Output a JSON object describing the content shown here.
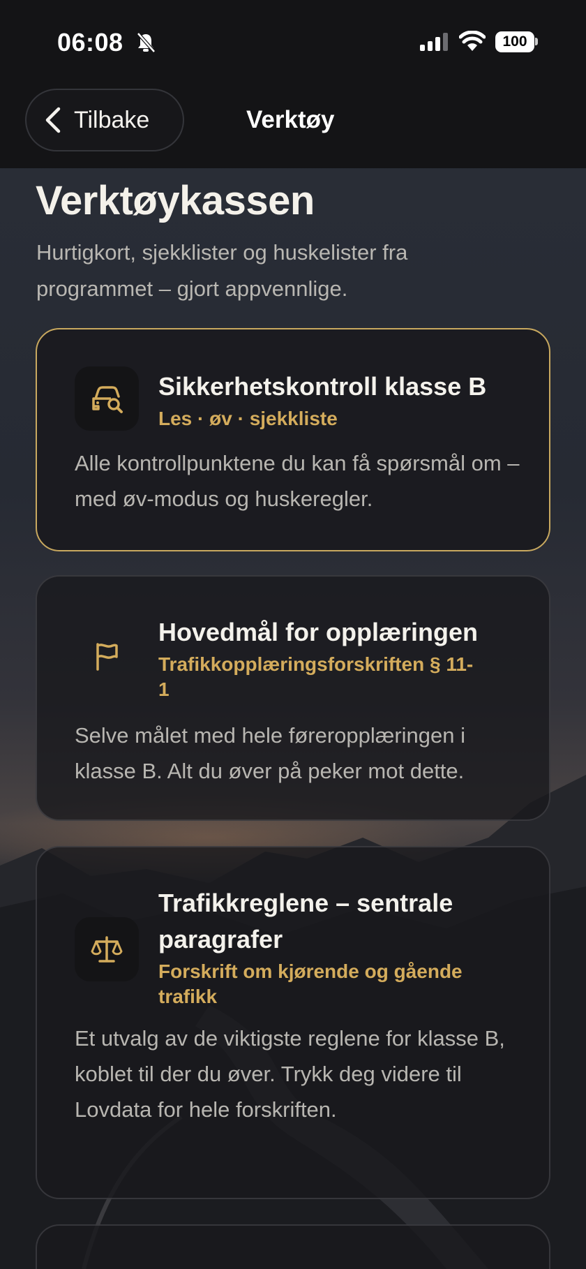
{
  "status_bar": {
    "time": "06:08",
    "battery": "100"
  },
  "header": {
    "back_label": "Tilbake",
    "title": "Verktøy"
  },
  "page": {
    "title": "Verktøykassen",
    "subtitle": "Hurtigkort, sjekklister og huskelister fra programmet – gjort appvennlige."
  },
  "cards": [
    {
      "icon": "car-inspection-icon",
      "title": "Sikkerhetskontroll klasse B",
      "meta": "Les · øv · sjekkliste",
      "description": "Alle kontrollpunktene du kan få spørsmål om – med øv-modus og huskeregler."
    },
    {
      "icon": "flag-icon",
      "title": "Hovedmål for opplæringen",
      "meta": "Trafikkopplæringsforskriften § 11-1",
      "description": "Selve målet med hele føreropplæringen i klasse B. Alt du øver på peker mot dette."
    },
    {
      "icon": "scales-icon",
      "title": "Trafikkreglene – sentrale paragrafer",
      "meta": "Forskrift om kjørende og gående trafikk",
      "description": "Et utvalg av de viktigste reglene for klasse B, koblet til der du øver. Trykk deg videre til Lovdata for hele forskriften."
    }
  ],
  "colors": {
    "accent": "#d4ac5c",
    "active_border": "#c9a95f",
    "background": "#1d1f26"
  }
}
